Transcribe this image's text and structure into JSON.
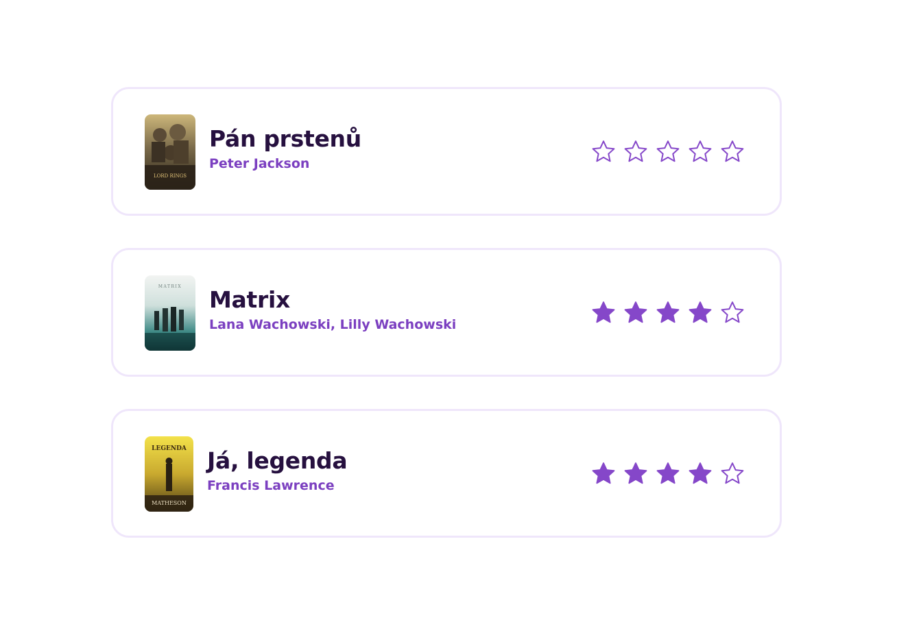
{
  "accent_color": "#8547c9",
  "title_color": "#26103f",
  "movies": [
    {
      "title": "Pán prstenů",
      "director": "Peter Jackson",
      "poster_icon": "lotr-poster",
      "rating": 0,
      "max_rating": 5,
      "poster_text": "LORD RINGS"
    },
    {
      "title": "Matrix",
      "director": "Lana Wachowski, Lilly Wachowski",
      "poster_icon": "matrix-poster",
      "rating": 4,
      "max_rating": 5,
      "poster_text": "MATRIX"
    },
    {
      "title": "Já, legenda",
      "director": "Francis Lawrence",
      "poster_icon": "i-am-legend-poster",
      "rating": 4,
      "max_rating": 5,
      "poster_text": "LEGENDA",
      "poster_subtext": "MATHESON"
    }
  ]
}
